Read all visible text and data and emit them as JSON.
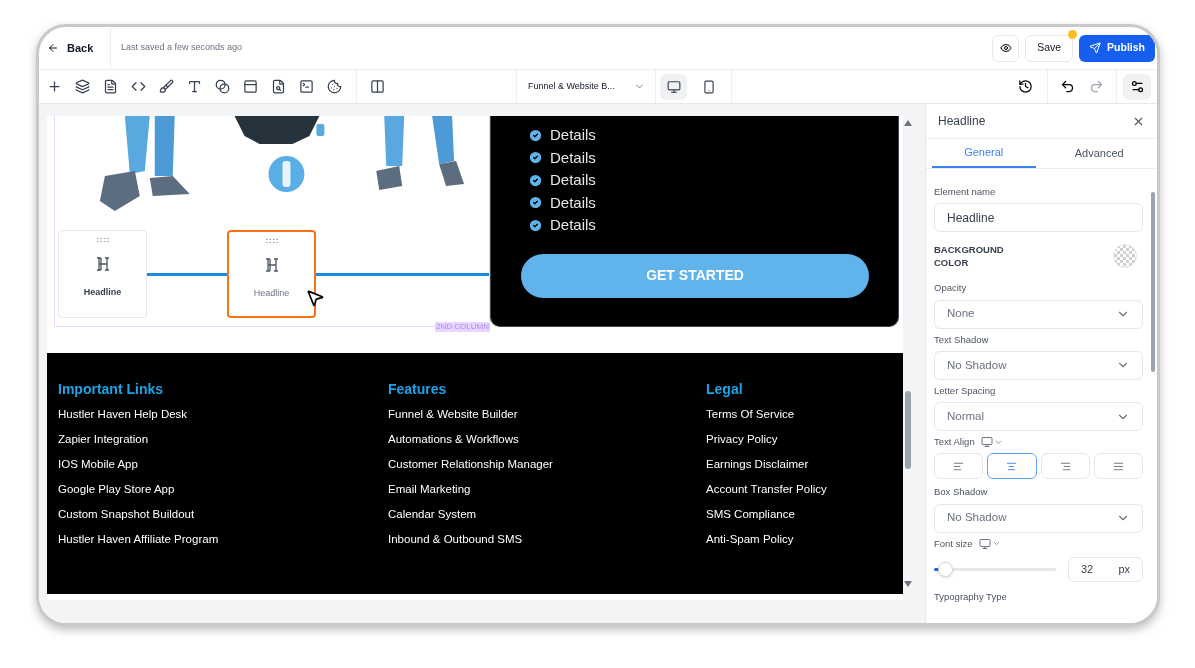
{
  "topbar": {
    "back": "Back",
    "last_saved": "Last saved a few seconds ago",
    "save": "Save",
    "publish": "Publish"
  },
  "toolbar": {
    "page_selector": "Funnel & Website B...",
    "devices": [
      {
        "kind": "desktop",
        "selected": true
      },
      {
        "kind": "mobile",
        "selected": false
      }
    ]
  },
  "canvas": {
    "elements": [
      {
        "label": "Headline",
        "selected": false
      },
      {
        "label": "Headline",
        "selected": true
      }
    ],
    "column_tag": "2ND COLUMN",
    "details": [
      "Details",
      "Details",
      "Details",
      "Details",
      "Details"
    ],
    "cta": "GET STARTED",
    "footer": [
      {
        "heading": "Important Links",
        "links": [
          "Hustler Haven Help Desk",
          "Zapier Integration",
          "IOS Mobile App",
          "Google Play Store App",
          "Custom Snapshot Buildout",
          "Hustler Haven Affiliate Program"
        ]
      },
      {
        "heading": "Features",
        "links": [
          "Funnel & Website Builder",
          "Automations & Workflows",
          "Customer Relationship Manager",
          "Email Marketing",
          "Calendar System",
          "Inbound & Outbound SMS"
        ]
      },
      {
        "heading": "Legal",
        "links": [
          "Terms Of Service",
          "Privacy Policy",
          "Earnings Disclaimer",
          "Account Transfer Policy",
          "SMS Compliance",
          "Anti-Spam Policy"
        ]
      }
    ]
  },
  "panel": {
    "title": "Headline",
    "tabs": [
      {
        "label": "General",
        "selected": true
      },
      {
        "label": "Advanced",
        "selected": false
      }
    ],
    "fields": [
      {
        "kind": "text",
        "label": "Element name",
        "value": "Headline"
      },
      {
        "kind": "color",
        "label": "BACKGROUND COLOR"
      },
      {
        "kind": "select",
        "label": "Opacity",
        "value": "None"
      },
      {
        "kind": "select",
        "label": "Text Shadow",
        "value": "No Shadow"
      },
      {
        "kind": "select",
        "label": "Letter Spacing",
        "value": "Normal"
      },
      {
        "kind": "align",
        "label": "Text Align",
        "options": [
          {
            "kind": "left",
            "selected": false
          },
          {
            "kind": "center",
            "selected": true
          },
          {
            "kind": "right",
            "selected": false
          },
          {
            "kind": "justify",
            "selected": false
          }
        ]
      },
      {
        "kind": "select",
        "label": "Box Shadow",
        "value": "No Shadow"
      },
      {
        "kind": "slider",
        "label": "Font size",
        "level": 0.05,
        "value": "32",
        "unit": "px"
      },
      {
        "kind": "heading",
        "label": "Typography Type"
      }
    ]
  }
}
